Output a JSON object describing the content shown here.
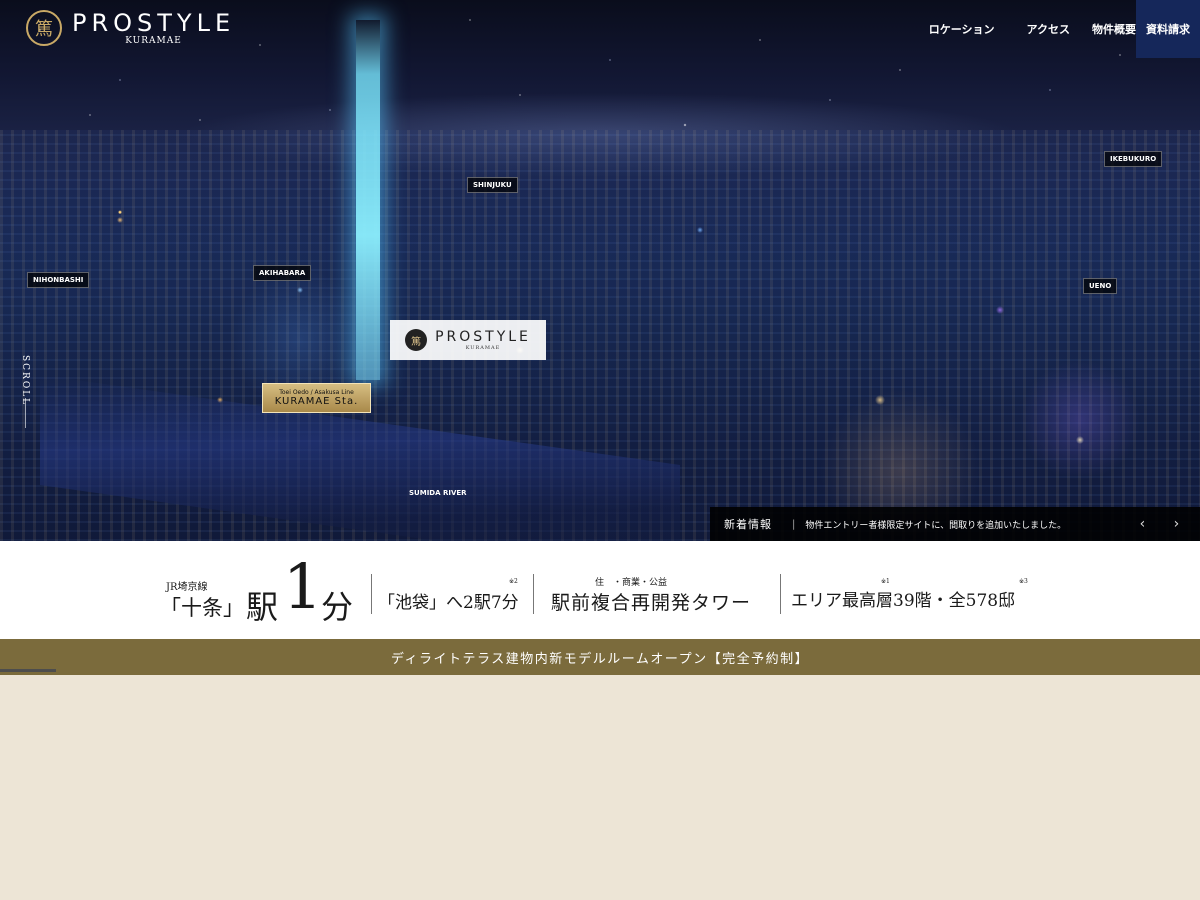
{
  "header": {
    "logo_title": "PROSTYLE",
    "logo_subtitle": "KURAMAE",
    "logo_mark": "篤",
    "nav": [
      "ロケーション",
      "アクセス",
      "物件概要"
    ],
    "request_label": "資料請求"
  },
  "hero": {
    "places": {
      "shinjuku": "SHINJUKU",
      "ikebukuro": "IKEBUKURO",
      "nihonbashi": "NIHONBASHI",
      "akihabara": "AKIHABARA",
      "ueno": "UENO",
      "sumida": "SUMIDA RIVER"
    },
    "badge_title": "PROSTYLE",
    "badge_subtitle": "KURAMAE",
    "station_line": "Toei Oedo / Asakusa Line",
    "station_name": "KURAMAE Sta.",
    "scroll_label": "SCROLL"
  },
  "news": {
    "label": "新着情報",
    "separator": "|",
    "text": "物件エントリー者様限定サイトに、間取りを追加いたしました。",
    "prev_icon": "chevron-left-icon",
    "next_icon": "chevron-right-icon"
  },
  "features": {
    "line_name": "JR埼京線",
    "station": "「十条」",
    "eki": "駅",
    "one": "1",
    "minute": "分",
    "ikebukuro_part": "「池袋」へ2駅7分",
    "note2": "※2",
    "ruby": "住　・商業・公益",
    "tower": "駅前複合再開発タワー",
    "area": "エリア最高層39階・全578邸",
    "note1": "※1",
    "note3": "※3"
  },
  "banner": {
    "text": "ディライトテラス建物内新モデルルームオープン【完全予約制】"
  },
  "colors": {
    "nav_request_bg": "#15275a",
    "banner_bg": "#7b6b3c",
    "page_bg": "#ede5d6",
    "gold": "#c9a966"
  }
}
